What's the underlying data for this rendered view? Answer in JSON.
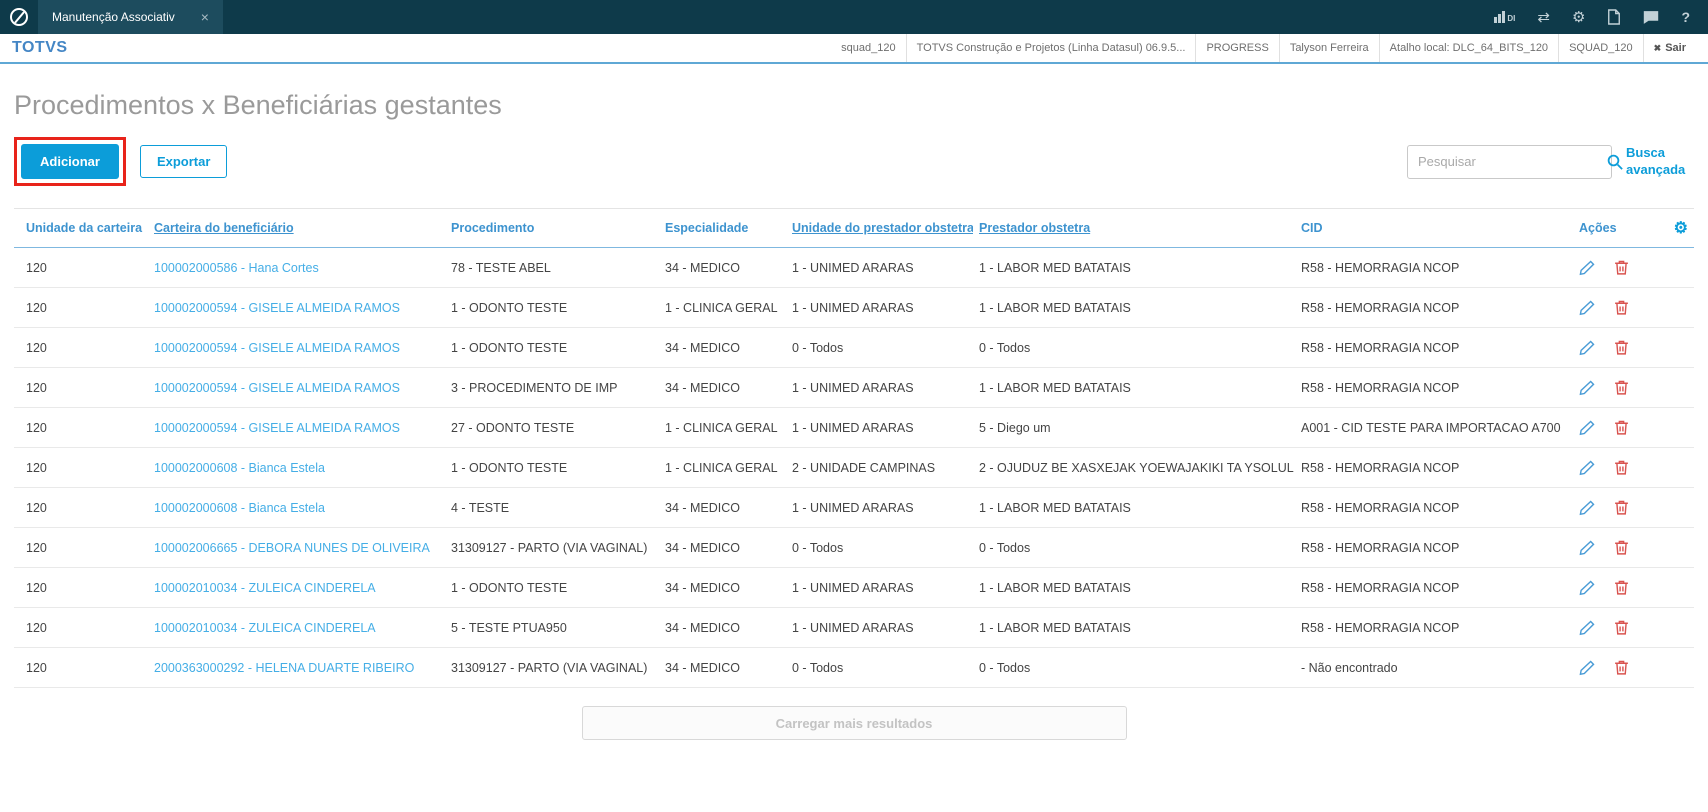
{
  "icons": {
    "close": "×",
    "shuffle": "⇄",
    "gear": "⚙",
    "help": "?",
    "exit": "✖"
  },
  "topbar": {
    "tab_label": "Manutenção Associativ",
    "di_label": "DI"
  },
  "header": {
    "brand": "TOTVS",
    "items": [
      "squad_120",
      "TOTVS Construção e Projetos (Linha Datasul) 06.9.5...",
      "PROGRESS",
      "Talyson Ferreira",
      "Atalho local: DLC_64_BITS_120",
      "SQUAD_120"
    ],
    "exit_label": "Sair"
  },
  "page": {
    "title": "Procedimentos x Beneficiárias gestantes",
    "buttons": {
      "add": "Adicionar",
      "export": "Exportar"
    },
    "search": {
      "placeholder": "Pesquisar"
    },
    "advanced_search": {
      "line1": "Busca",
      "line2": "avançada"
    },
    "load_more": "Carregar mais resultados"
  },
  "table": {
    "headers": [
      "Unidade da carteira",
      "Carteira do beneficiário",
      "Procedimento",
      "Especialidade",
      "Unidade do prestador obstetra",
      "Prestador obstetra",
      "CID",
      "Ações"
    ],
    "rows": [
      {
        "unidade": "120",
        "carteira": "100002000586 - Hana Cortes",
        "procedimento": "78 - TESTE ABEL",
        "especialidade": "34 - MEDICO",
        "unidade_prestador": "1 - UNIMED ARARAS",
        "prestador": "1 - LABOR MED BATATAIS",
        "cid": "R58 - HEMORRAGIA NCOP"
      },
      {
        "unidade": "120",
        "carteira": "100002000594 - GISELE ALMEIDA RAMOS",
        "procedimento": "1 - ODONTO TESTE",
        "especialidade": "1 - CLINICA GERAL",
        "unidade_prestador": "1 - UNIMED ARARAS",
        "prestador": "1 - LABOR MED BATATAIS",
        "cid": "R58 - HEMORRAGIA NCOP"
      },
      {
        "unidade": "120",
        "carteira": "100002000594 - GISELE ALMEIDA RAMOS",
        "procedimento": "1 - ODONTO TESTE",
        "especialidade": "34 - MEDICO",
        "unidade_prestador": "0 - Todos",
        "prestador": "0 - Todos",
        "cid": "R58 - HEMORRAGIA NCOP"
      },
      {
        "unidade": "120",
        "carteira": "100002000594 - GISELE ALMEIDA RAMOS",
        "procedimento": "3 - PROCEDIMENTO DE IMP",
        "especialidade": "34 - MEDICO",
        "unidade_prestador": "1 - UNIMED ARARAS",
        "prestador": "1 - LABOR MED BATATAIS",
        "cid": "R58 - HEMORRAGIA NCOP"
      },
      {
        "unidade": "120",
        "carteira": "100002000594 - GISELE ALMEIDA RAMOS",
        "procedimento": "27 - ODONTO TESTE",
        "especialidade": "1 - CLINICA GERAL",
        "unidade_prestador": "1 - UNIMED ARARAS",
        "prestador": "5 - Diego um",
        "cid": "A001 - CID TESTE PARA IMPORTACAO A700"
      },
      {
        "unidade": "120",
        "carteira": "100002000608 - Bianca Estela",
        "procedimento": "1 - ODONTO TESTE",
        "especialidade": "1 - CLINICA GERAL",
        "unidade_prestador": "2 - UNIDADE CAMPINAS",
        "prestador": "2 - OJUDUZ BE XASXEJAK YOEWAJAKIKI TA YSOLUL",
        "cid": "R58 - HEMORRAGIA NCOP"
      },
      {
        "unidade": "120",
        "carteira": "100002000608 - Bianca Estela",
        "procedimento": "4 - TESTE",
        "especialidade": "34 - MEDICO",
        "unidade_prestador": "1 - UNIMED ARARAS",
        "prestador": "1 - LABOR MED BATATAIS",
        "cid": "R58 - HEMORRAGIA NCOP"
      },
      {
        "unidade": "120",
        "carteira": "100002006665 - DEBORA NUNES DE OLIVEIRA",
        "procedimento": "31309127 - PARTO (VIA VAGINAL)",
        "especialidade": "34 - MEDICO",
        "unidade_prestador": "0 - Todos",
        "prestador": "0 - Todos",
        "cid": "R58 - HEMORRAGIA NCOP"
      },
      {
        "unidade": "120",
        "carteira": "100002010034 - ZULEICA CINDERELA",
        "procedimento": "1 - ODONTO TESTE",
        "especialidade": "34 - MEDICO",
        "unidade_prestador": "1 - UNIMED ARARAS",
        "prestador": "1 - LABOR MED BATATAIS",
        "cid": "R58 - HEMORRAGIA NCOP"
      },
      {
        "unidade": "120",
        "carteira": "100002010034 - ZULEICA CINDERELA",
        "procedimento": "5 - TESTE PTUA950",
        "especialidade": "34 - MEDICO",
        "unidade_prestador": "1 - UNIMED ARARAS",
        "prestador": "1 - LABOR MED BATATAIS",
        "cid": "R58 - HEMORRAGIA NCOP"
      },
      {
        "unidade": "120",
        "carteira": "2000363000292 - HELENA DUARTE RIBEIRO",
        "procedimento": "31309127 - PARTO (VIA VAGINAL)",
        "especialidade": "34 - MEDICO",
        "unidade_prestador": "0 - Todos",
        "prestador": "0 - Todos",
        "cid": "- Não encontrado"
      }
    ]
  },
  "colors": {
    "topbar_bg": "#0e3a4a",
    "accent_blue": "#0c9dd9",
    "table_header_text": "#3d93cf",
    "row_link_blue": "#45aee6",
    "delete_red": "#d9534f",
    "annotation_red": "#e8231a",
    "title_gray": "#9a9a9a"
  }
}
